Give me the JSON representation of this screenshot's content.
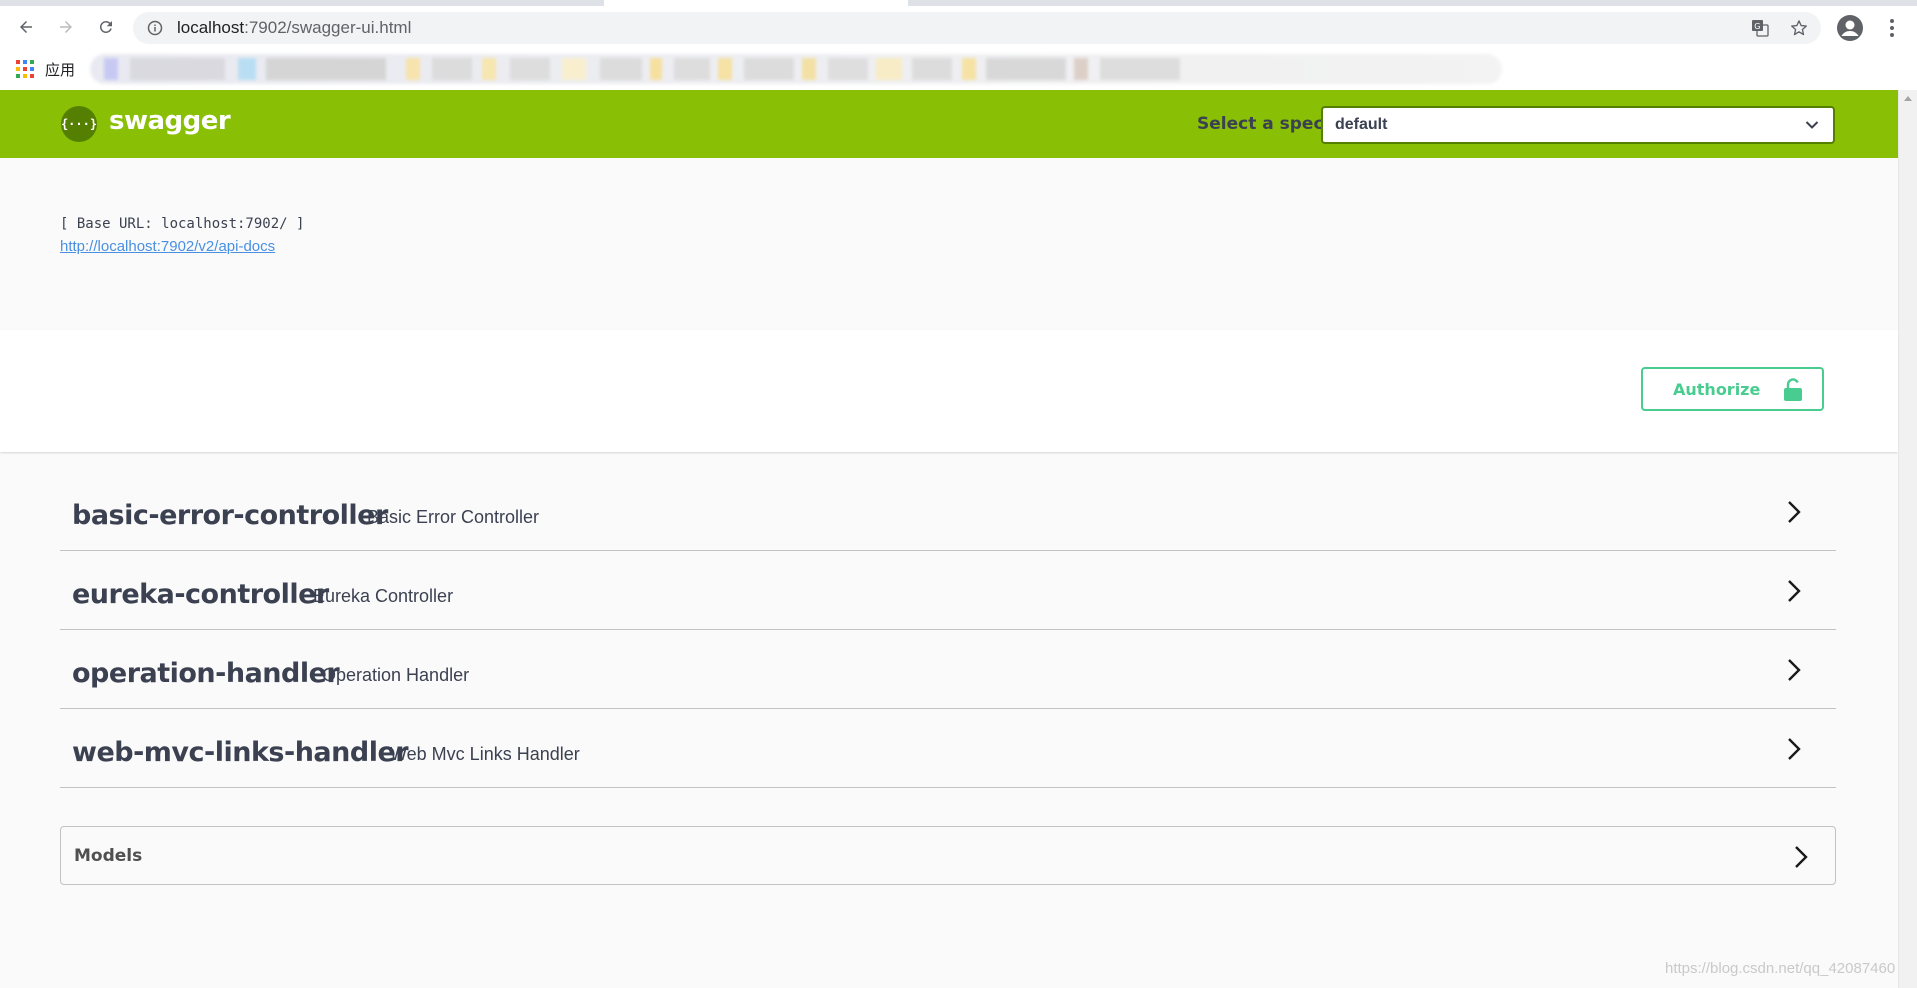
{
  "browser": {
    "url_host": "localhost",
    "url_rest": ":7902/swagger-ui.html",
    "apps_label": "应用"
  },
  "header": {
    "logo_symbol": "{···}",
    "logo_text": "swagger",
    "spec_label": "Select a spec",
    "spec_value": "default",
    "brand_color": "#89bf04"
  },
  "info": {
    "base_url": "[ Base URL: localhost:7902/ ]",
    "api_docs_link": "http://localhost:7902/v2/api-docs"
  },
  "authorize": {
    "label": "Authorize",
    "color": "#49cc90"
  },
  "tags": [
    {
      "name": "basic-error-controller",
      "description": "Basic Error Controller"
    },
    {
      "name": "eureka-controller",
      "description": "Eureka Controller"
    },
    {
      "name": "operation-handler",
      "description": "Operation Handler"
    },
    {
      "name": "web-mvc-links-handler",
      "description": "Web Mvc Links Handler"
    }
  ],
  "models": {
    "title": "Models"
  },
  "watermark": "https://blog.csdn.net/qq_42087460"
}
